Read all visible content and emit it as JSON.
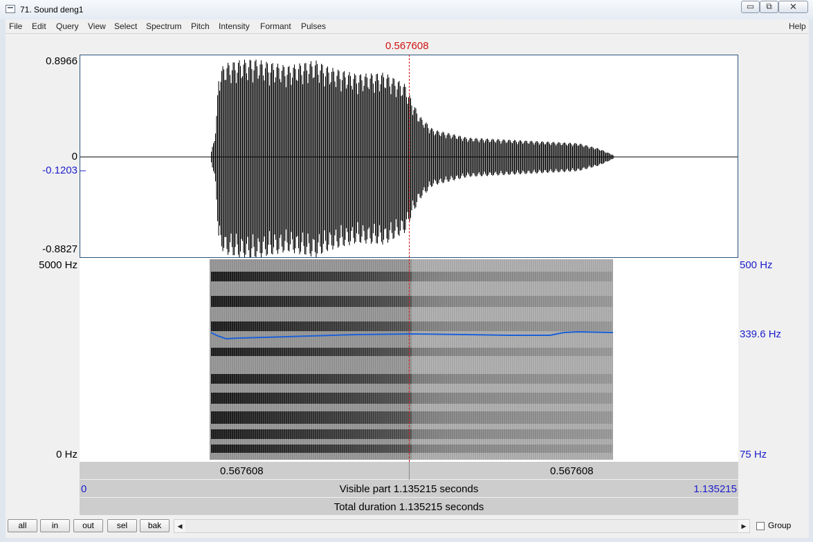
{
  "window": {
    "title": "71. Sound deng1",
    "minimize_glyph": "▭",
    "maximize_glyph": "⧉",
    "close_glyph": "✕"
  },
  "menu": {
    "items": [
      "File",
      "Edit",
      "Query",
      "View",
      "Select",
      "Spectrum",
      "Pitch",
      "Intensity",
      "Formant",
      "Pulses"
    ],
    "help": "Help"
  },
  "cursor": {
    "time_label": "0.567608",
    "time_s": 0.567608
  },
  "waveform": {
    "y_max": "0.8966",
    "y_zero": "0",
    "y_cursor_value": "-0.1203",
    "y_min": "-0.8827"
  },
  "spectrogram": {
    "freq_max": "5000 Hz",
    "freq_min": "0 Hz",
    "pitch_max": "500 Hz",
    "pitch_cursor": "339.6 Hz",
    "pitch_min": "75 Hz"
  },
  "timebars": {
    "cursor_left": "0.567608",
    "cursor_right": "0.567608",
    "visible_start": "0",
    "visible_label": "Visible part 1.135215 seconds",
    "visible_end": "1.135215",
    "total_label": "Total duration 1.135215 seconds"
  },
  "zoom_buttons": {
    "all": "all",
    "in": "in",
    "out": "out",
    "sel": "sel",
    "bak": "bak"
  },
  "scrollbar": {
    "left_arrow": "◀",
    "right_arrow": "▶"
  },
  "group": {
    "label": "Group",
    "checked": false
  },
  "colors": {
    "cursor": "#d01010",
    "pitch": "#1a5fd8",
    "axis_blue": "#1c1ccc"
  }
}
